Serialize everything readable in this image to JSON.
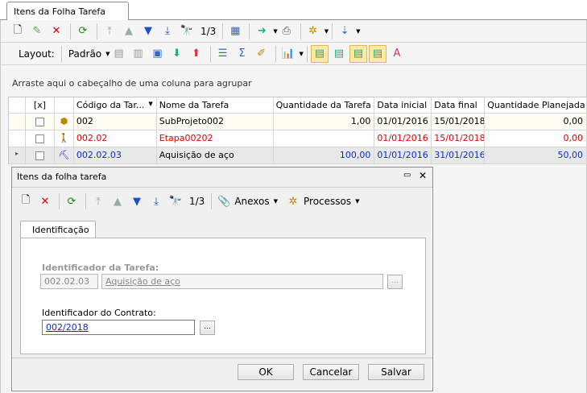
{
  "tab": {
    "title": "Itens da Folha Tarefa"
  },
  "toolbar1": {
    "record_counter": "1/3"
  },
  "toolbar2": {
    "layout_label": "Layout:",
    "layout_value": "Padrão"
  },
  "grid": {
    "group_hint": "Arraste aqui o cabeçalho de uma coluna para agrupar",
    "columns": [
      "[x]",
      "Código da Tar...",
      "Nome da Tarefa",
      "Quantidade da Tarefa",
      "Data inicial",
      "Data final",
      "Quantidade Planejada"
    ],
    "rows": [
      {
        "codigo": "002",
        "nome": "SubProjeto002",
        "qtd_tarefa": "1,00",
        "data_inicial": "01/01/2016",
        "data_final": "15/01/2018",
        "qtd_planejada": "0,00"
      },
      {
        "codigo": "002.02",
        "nome": "Etapa00202",
        "qtd_tarefa": "",
        "data_inicial": "01/01/2016",
        "data_final": "15/01/2018",
        "qtd_planejada": "0,00"
      },
      {
        "codigo": "002.02.03",
        "nome": "Aquisição de aço",
        "qtd_tarefa": "100,00",
        "data_inicial": "01/01/2016",
        "data_final": "31/01/2016",
        "qtd_planejada": "50,00"
      }
    ]
  },
  "dialog": {
    "title": "Itens da folha tarefa",
    "record_counter": "1/3",
    "anexos_label": "Anexos",
    "processos_label": "Processos",
    "tab_label": "Identificação",
    "task_id_label": "Identificador da Tarefa:",
    "task_id_value": "002.02.03",
    "task_name_value": "Aquisição de aço",
    "contract_id_label": "Identificador do Contrato:",
    "contract_id_value": "002/2018",
    "ok_label": "OK",
    "cancel_label": "Cancelar",
    "save_label": "Salvar"
  },
  "colors": {
    "accent_red": "#d00000",
    "accent_blue": "#0a2fc9",
    "highlight": "#ffe9a6"
  }
}
